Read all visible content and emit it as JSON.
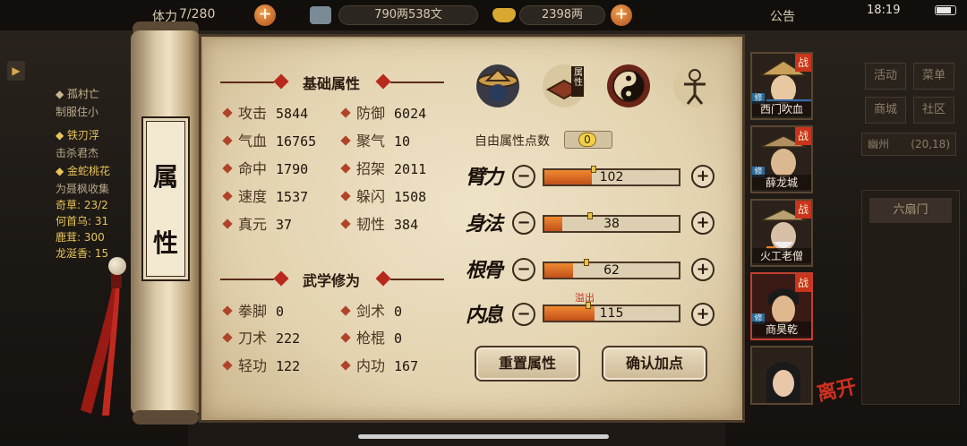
{
  "status": {
    "time": "18:19"
  },
  "topbar": {
    "stamina_label": "体力",
    "stamina": "7/280",
    "money": "790两538文",
    "gold": "2398两",
    "notice": "公告"
  },
  "quests": [
    {
      "text": "◆ 孤村亡",
      "style": "yellow"
    },
    {
      "text": "制服住小",
      "style": ""
    },
    {
      "text": "◆ 铁刃浮",
      "style": "yellow"
    },
    {
      "text": "击杀君杰",
      "style": ""
    },
    {
      "text": "◆ 金蛇桃花",
      "style": "yellow"
    },
    {
      "text": "为聂枫收集",
      "style": ""
    },
    {
      "text": "奇草: 23/2",
      "style": "yellow"
    },
    {
      "text": "何首乌: 31",
      "style": "yellow"
    },
    {
      "text": "鹿茸: 300",
      "style": "yellow"
    },
    {
      "text": "龙涎香: 15",
      "style": "yellow"
    }
  ],
  "right_menu": {
    "buttons": [
      "活动",
      "菜单",
      "商城",
      "社区"
    ],
    "location_name": "幽州",
    "location_coords": "(20,18)",
    "gate": "六扇门"
  },
  "scroll": {
    "title_char_1": "属",
    "title_char_2": "性"
  },
  "basic": {
    "heading": "基础属性",
    "stats": [
      {
        "label": "攻击",
        "value": "5844"
      },
      {
        "label": "防御",
        "value": "6024"
      },
      {
        "label": "气血",
        "value": "16765"
      },
      {
        "label": "聚气",
        "value": "10"
      },
      {
        "label": "命中",
        "value": "1790"
      },
      {
        "label": "招架",
        "value": "2011"
      },
      {
        "label": "速度",
        "value": "1537"
      },
      {
        "label": "躲闪",
        "value": "1508"
      },
      {
        "label": "真元",
        "value": "37"
      },
      {
        "label": "韧性",
        "value": "384"
      }
    ]
  },
  "martial": {
    "heading": "武学修为",
    "stats": [
      {
        "label": "拳脚",
        "value": "0"
      },
      {
        "label": "剑术",
        "value": "0"
      },
      {
        "label": "刀术",
        "value": "222"
      },
      {
        "label": "枪棍",
        "value": "0"
      },
      {
        "label": "轻功",
        "value": "122"
      },
      {
        "label": "内功",
        "value": "167"
      }
    ]
  },
  "tabs": {
    "items": [
      {
        "icon": "hat-figure-icon",
        "label": ""
      },
      {
        "icon": "book-icon",
        "label": "属性"
      },
      {
        "icon": "bagua-icon",
        "label": ""
      },
      {
        "icon": "martial-figure-icon",
        "label": ""
      }
    ]
  },
  "free_points": {
    "label": "自由属性点数",
    "value": "0"
  },
  "attributes": [
    {
      "name": "臂力",
      "value": "102",
      "fill": 0.35
    },
    {
      "name": "身法",
      "value": "38",
      "fill": 0.13
    },
    {
      "name": "根骨",
      "value": "62",
      "fill": 0.21
    },
    {
      "name": "内息",
      "value": "115",
      "fill": 0.37
    }
  ],
  "overflow_label": "溢出",
  "buttons": {
    "reset": "重置属性",
    "confirm": "确认加点"
  },
  "characters": [
    {
      "name": "西门吹血",
      "battle": "战",
      "level_tag": "修",
      "selected": false
    },
    {
      "name": "薛龙城",
      "battle": "战",
      "level_tag": "修",
      "selected": false
    },
    {
      "name": "火工老僧",
      "battle": "战",
      "level_tag": "修",
      "selected": false
    },
    {
      "name": "商昊乾",
      "battle": "战",
      "level_tag": "修",
      "selected": true
    },
    {
      "name": "",
      "battle": "",
      "level_tag": "",
      "selected": false
    }
  ],
  "leave_label": "离开",
  "colors": {
    "accent": "#b8281c",
    "bar_fill": "#e07428",
    "parchment": "#e8dabb"
  }
}
